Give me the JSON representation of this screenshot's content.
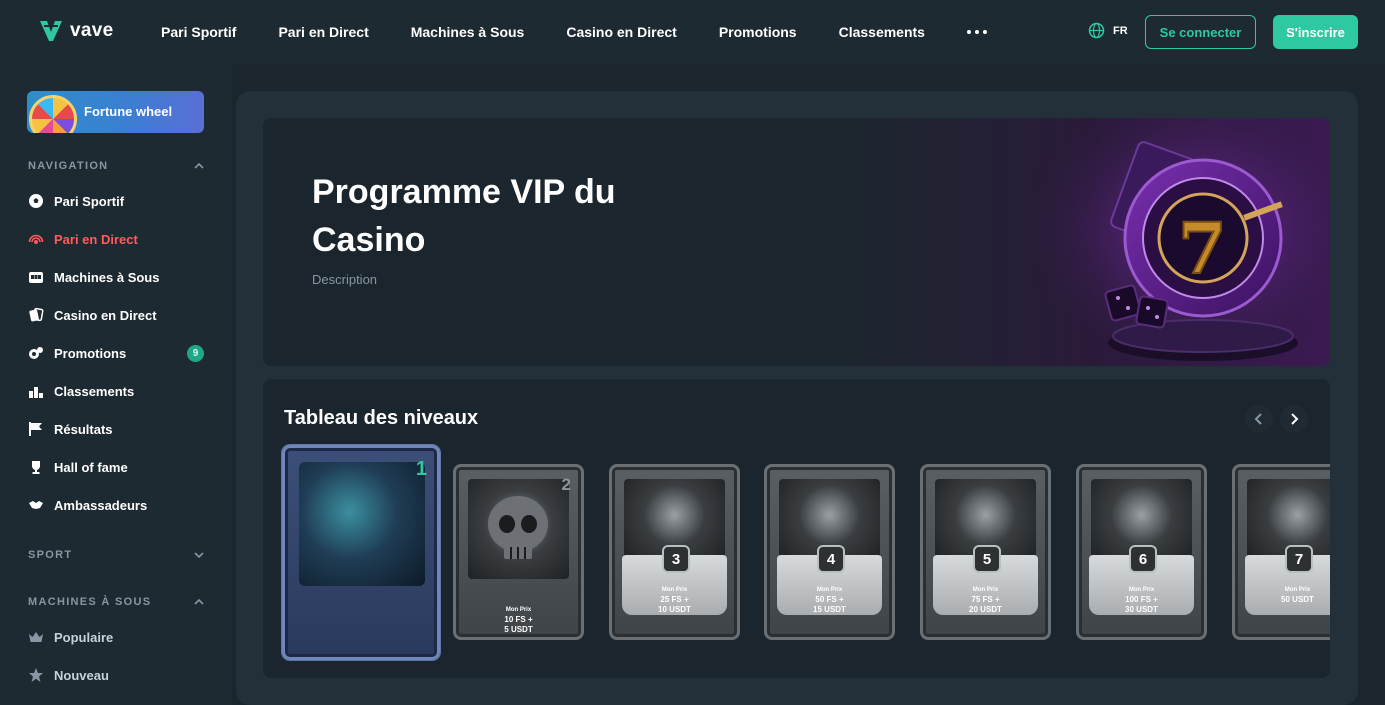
{
  "header": {
    "logo_text": "vave",
    "nav": [
      "Pari Sportif",
      "Pari en Direct",
      "Machines à Sous",
      "Casino en Direct",
      "Promotions",
      "Classements"
    ],
    "lang": "FR",
    "login_label": "Se connecter",
    "signup_label": "S'inscrire"
  },
  "sidebar": {
    "fortune_label": "Fortune wheel",
    "navigation_title": "NAVIGATION",
    "items": [
      {
        "label": "Pari Sportif"
      },
      {
        "label": "Pari en Direct"
      },
      {
        "label": "Machines à Sous"
      },
      {
        "label": "Casino en Direct"
      },
      {
        "label": "Promotions",
        "badge": "9"
      },
      {
        "label": "Classements"
      },
      {
        "label": "Résultats"
      },
      {
        "label": "Hall of fame"
      },
      {
        "label": "Ambassadeurs"
      }
    ],
    "sport_title": "SPORT",
    "slots_title": "MACHINES À SOUS",
    "slots_items": [
      {
        "label": "Populaire"
      },
      {
        "label": "Nouveau"
      }
    ]
  },
  "hero": {
    "title": "Programme VIP du Casino",
    "description": "Description"
  },
  "levels": {
    "title": "Tableau des niveaux",
    "cards": [
      {
        "level": "1"
      },
      {
        "level": "2",
        "prize_head": "Mon Prix",
        "prize": "10 FS +",
        "prize2": "5 USDT"
      },
      {
        "level": "3",
        "prize_head": "Mon Prix",
        "prize": "25 FS +",
        "prize2": "10 USDT"
      },
      {
        "level": "4",
        "prize_head": "Mon Prix",
        "prize": "50 FS +",
        "prize2": "15 USDT"
      },
      {
        "level": "5",
        "prize_head": "Mon Prix",
        "prize": "75 FS +",
        "prize2": "20 USDT"
      },
      {
        "level": "6",
        "prize_head": "Mon Prix",
        "prize": "100 FS +",
        "prize2": "30 USDT"
      },
      {
        "level": "7",
        "prize_head": "Mon Prix",
        "prize": "50 USDT",
        "prize2": ""
      }
    ]
  },
  "colors": {
    "accent": "#2ec9a0",
    "active_nav": "#ff5b5b",
    "background": "#1b252d",
    "panel": "#23303a"
  }
}
